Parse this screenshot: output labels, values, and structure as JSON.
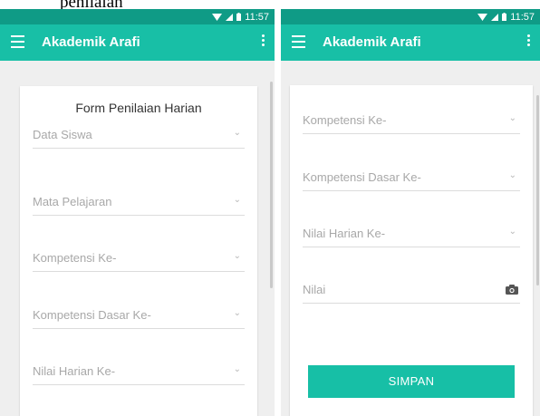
{
  "caption": "penilaian",
  "colors": {
    "statusbar": "#0f9b86",
    "appbar": "#18bfa6",
    "button": "#17bfa6"
  },
  "status": {
    "time": "11:57"
  },
  "app": {
    "title": "Akademik Arafi"
  },
  "left_screen": {
    "form_title": "Form Penilaian Harian",
    "fields": [
      {
        "label": "Data Siswa",
        "icon": "chevron-down-icon"
      },
      {
        "label": "Mata Pelajaran",
        "icon": "chevron-down-icon"
      },
      {
        "label": "Kompetensi Ke-",
        "icon": "chevron-down-icon"
      },
      {
        "label": "Kompetensi Dasar Ke-",
        "icon": "chevron-down-icon"
      },
      {
        "label": "Nilai Harian Ke-",
        "icon": "chevron-down-icon"
      }
    ]
  },
  "right_screen": {
    "fields": [
      {
        "label": "Kompetensi Ke-",
        "icon": "chevron-down-icon"
      },
      {
        "label": "Kompetensi Dasar Ke-",
        "icon": "chevron-down-icon"
      },
      {
        "label": "Nilai Harian Ke-",
        "icon": "chevron-down-icon"
      },
      {
        "placeholder": "Nilai",
        "icon": "camera-icon"
      }
    ],
    "button_label": "SIMPAN"
  }
}
